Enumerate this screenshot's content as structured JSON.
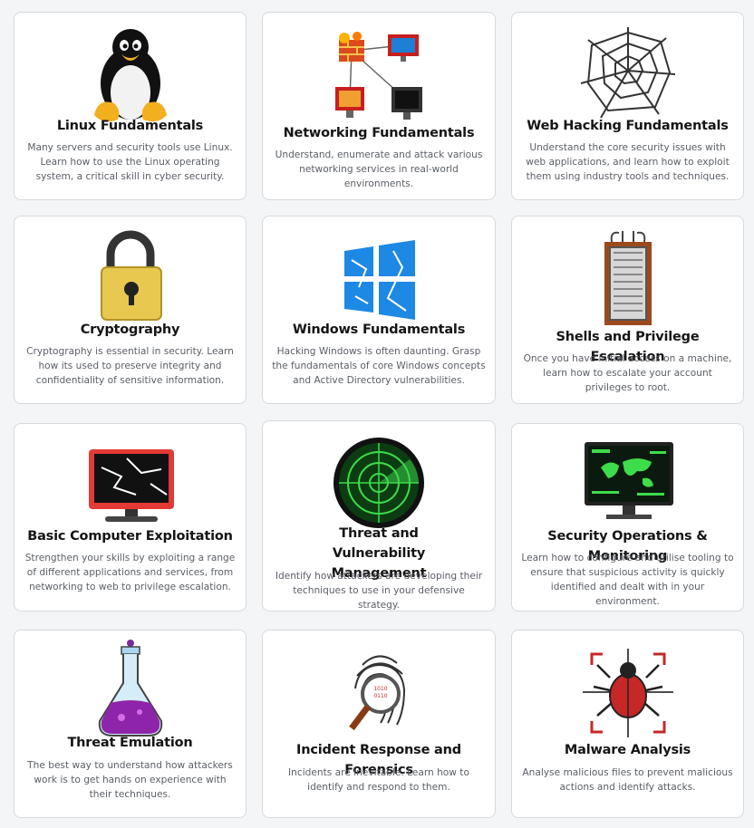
{
  "modules": [
    {
      "title": "Linux Fundamentals",
      "description": "Many servers and security tools use Linux. Learn how to use the Linux operating system, a critical skill in cyber security.",
      "icon": "penguin-icon"
    },
    {
      "title": "Networking Fundamentals",
      "description": "Understand, enumerate and attack various networking services in real-world environments.",
      "icon": "network-icon"
    },
    {
      "title": "Web Hacking Fundamentals",
      "description": "Understand the core security issues with web applications, and learn how to exploit them using industry tools and techniques.",
      "icon": "spider-web-icon"
    },
    {
      "title": "Cryptography",
      "description": "Cryptography is essential in security. Learn how its used to preserve integrity and confidentiality of sensitive information.",
      "icon": "padlock-icon"
    },
    {
      "title": "Windows Fundamentals",
      "description": "Hacking Windows is often daunting. Grasp the fundamentals of core Windows concepts and Active Directory vulnerabilities.",
      "icon": "windows-logo-icon"
    },
    {
      "title": "Shells and Privilege Escalation",
      "description": "Once you have initial access on a machine, learn how to escalate your account privileges to root.",
      "icon": "elevator-icon"
    },
    {
      "title": "Basic Computer Exploitation",
      "description": "Strengthen your skills by exploiting a range of different applications and services, from networking to web to privilege escalation.",
      "icon": "cracked-monitor-icon"
    },
    {
      "title": "Threat and Vulnerability Management",
      "description": "Identify how attackers are developing their techniques to use in your defensive strategy.",
      "icon": "radar-icon"
    },
    {
      "title": "Security Operations & Monitoring",
      "description": "Learn how to configure and utilise tooling to ensure that suspicious activity is quickly identified and dealt with in your environment.",
      "icon": "world-map-monitor-icon"
    },
    {
      "title": "Threat Emulation",
      "description": "The best way to understand how attackers work is to get hands on experience with their techniques.",
      "icon": "flask-icon"
    },
    {
      "title": "Incident Response and Forensics",
      "description": "Incidents are inevitable. Learn how to identify and respond to them.",
      "icon": "fingerprint-icon"
    },
    {
      "title": "Malware Analysis",
      "description": "Analyse malicious files to prevent malicious actions and identify attacks.",
      "icon": "bug-target-icon"
    }
  ]
}
